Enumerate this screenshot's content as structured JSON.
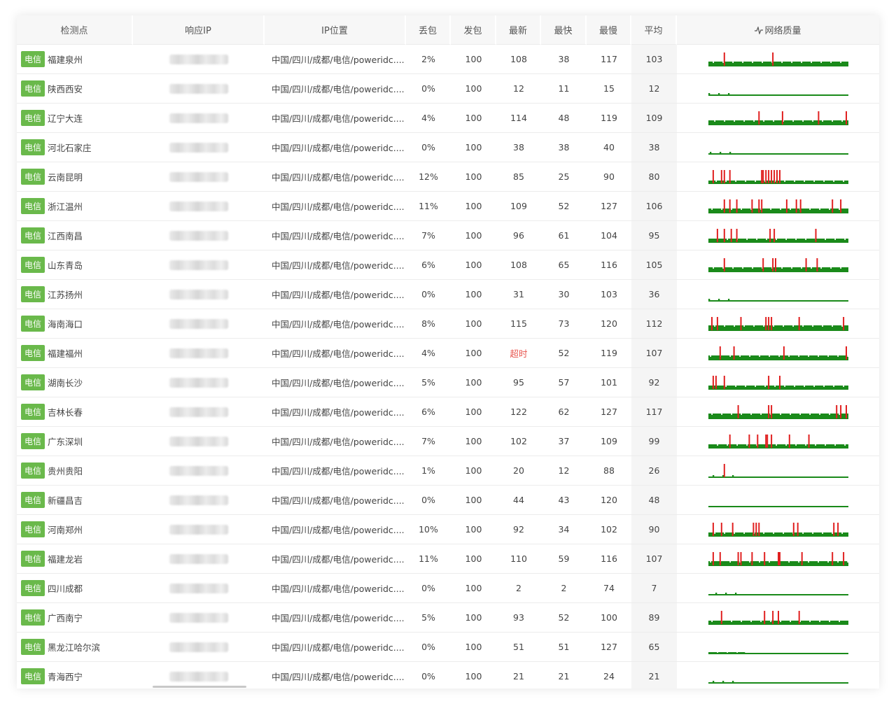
{
  "headers": {
    "node": "检测点",
    "ip": "响应IP",
    "location": "IP位置",
    "loss": "丢包",
    "sent": "发包",
    "latest": "最新",
    "fastest": "最快",
    "slowest": "最慢",
    "avg": "平均",
    "quality": "网络质量"
  },
  "colors": {
    "tag": "#6ab94b",
    "good": "#1a8a1a",
    "loss": "#e02020",
    "timeout": "#e8554e"
  },
  "rows": [
    {
      "isp": "电信",
      "city": "福建泉州",
      "location": "中国/四川/成都/电信/poweridc....",
      "loss": "2%",
      "sent": "100",
      "latest": "108",
      "fastest": "38",
      "slowest": "117",
      "avg": "103",
      "level": 0.5,
      "spikes": [
        0.11,
        0.46
      ]
    },
    {
      "isp": "电信",
      "city": "陕西西安",
      "location": "中国/四川/成都/电信/poweridc....",
      "loss": "0%",
      "sent": "100",
      "latest": "12",
      "fastest": "11",
      "slowest": "15",
      "avg": "12",
      "level": 0.05,
      "spikes": []
    },
    {
      "isp": "电信",
      "city": "辽宁大连",
      "location": "中国/四川/成都/电信/poweridc....",
      "loss": "4%",
      "sent": "100",
      "latest": "114",
      "fastest": "48",
      "slowest": "119",
      "avg": "109",
      "level": 0.52,
      "spikes": [
        0.36,
        0.53,
        0.79,
        0.99
      ]
    },
    {
      "isp": "电信",
      "city": "河北石家庄",
      "location": "中国/四川/成都/电信/poweridc....",
      "loss": "0%",
      "sent": "100",
      "latest": "38",
      "fastest": "38",
      "slowest": "40",
      "avg": "38",
      "level": 0.05,
      "spikes": []
    },
    {
      "isp": "电信",
      "city": "云南昆明",
      "location": "中国/四川/成都/电信/poweridc....",
      "loss": "12%",
      "sent": "100",
      "latest": "85",
      "fastest": "25",
      "slowest": "90",
      "avg": "80",
      "level": 0.3,
      "spikes": [
        0.03,
        0.09,
        0.11,
        0.15,
        0.38,
        0.39,
        0.41,
        0.43,
        0.45,
        0.47,
        0.49,
        0.51
      ]
    },
    {
      "isp": "电信",
      "city": "浙江温州",
      "location": "中国/四川/成都/电信/poweridc....",
      "loss": "11%",
      "sent": "100",
      "latest": "109",
      "fastest": "52",
      "slowest": "127",
      "avg": "106",
      "level": 0.52,
      "spikes": [
        0.11,
        0.15,
        0.2,
        0.31,
        0.36,
        0.38,
        0.56,
        0.63,
        0.66,
        0.89,
        0.95
      ]
    },
    {
      "isp": "电信",
      "city": "江西南昌",
      "location": "中国/四川/成都/电信/poweridc....",
      "loss": "7%",
      "sent": "100",
      "latest": "96",
      "fastest": "61",
      "slowest": "104",
      "avg": "95",
      "level": 0.45,
      "spikes": [
        0.06,
        0.11,
        0.16,
        0.2,
        0.44,
        0.47,
        0.77
      ]
    },
    {
      "isp": "电信",
      "city": "山东青岛",
      "location": "中国/四川/成都/电信/poweridc....",
      "loss": "6%",
      "sent": "100",
      "latest": "108",
      "fastest": "65",
      "slowest": "116",
      "avg": "105",
      "level": 0.5,
      "spikes": [
        0.11,
        0.39,
        0.46,
        0.48,
        0.7,
        0.78
      ]
    },
    {
      "isp": "电信",
      "city": "江苏扬州",
      "location": "中国/四川/成都/电信/poweridc....",
      "loss": "0%",
      "sent": "100",
      "latest": "31",
      "fastest": "30",
      "slowest": "103",
      "avg": "36",
      "level": 0.08,
      "spikes": []
    },
    {
      "isp": "电信",
      "city": "海南海口",
      "location": "中国/四川/成都/电信/poweridc....",
      "loss": "8%",
      "sent": "100",
      "latest": "115",
      "fastest": "73",
      "slowest": "120",
      "avg": "112",
      "level": 0.55,
      "spikes": [
        0.02,
        0.06,
        0.23,
        0.41,
        0.43,
        0.45,
        0.65,
        0.97
      ]
    },
    {
      "isp": "电信",
      "city": "福建福州",
      "location": "中国/四川/成都/电信/poweridc....",
      "loss": "4%",
      "sent": "100",
      "latest": "超时",
      "fastest": "52",
      "slowest": "119",
      "avg": "107",
      "level": 0.5,
      "spikes": [
        0.08,
        0.18,
        0.54,
        0.99
      ],
      "latest_timeout": true
    },
    {
      "isp": "电信",
      "city": "湖南长沙",
      "location": "中国/四川/成都/电信/poweridc....",
      "loss": "5%",
      "sent": "100",
      "latest": "95",
      "fastest": "57",
      "slowest": "101",
      "avg": "92",
      "level": 0.45,
      "spikes": [
        0.03,
        0.05,
        0.11,
        0.43,
        0.51
      ]
    },
    {
      "isp": "电信",
      "city": "吉林长春",
      "location": "中国/四川/成都/电信/poweridc....",
      "loss": "6%",
      "sent": "100",
      "latest": "122",
      "fastest": "62",
      "slowest": "127",
      "avg": "117",
      "level": 0.55,
      "spikes": [
        0.21,
        0.43,
        0.45,
        0.92,
        0.95,
        0.99
      ]
    },
    {
      "isp": "电信",
      "city": "广东深圳",
      "location": "中国/四川/成都/电信/poweridc....",
      "loss": "7%",
      "sent": "100",
      "latest": "102",
      "fastest": "37",
      "slowest": "109",
      "avg": "99",
      "level": 0.45,
      "spikes": [
        0.15,
        0.29,
        0.35,
        0.41,
        0.42,
        0.45,
        0.58,
        0.72
      ]
    },
    {
      "isp": "电信",
      "city": "贵州贵阳",
      "location": "中国/四川/成都/电信/poweridc....",
      "loss": "1%",
      "sent": "100",
      "latest": "20",
      "fastest": "12",
      "slowest": "88",
      "avg": "26",
      "level": 0.08,
      "spikes": [
        0.11
      ]
    },
    {
      "isp": "电信",
      "city": "新疆昌吉",
      "location": "中国/四川/成都/电信/poweridc....",
      "loss": "0%",
      "sent": "100",
      "latest": "44",
      "fastest": "43",
      "slowest": "120",
      "avg": "48",
      "level": 0.12,
      "spikes": []
    },
    {
      "isp": "电信",
      "city": "河南郑州",
      "location": "中国/四川/成都/电信/poweridc....",
      "loss": "10%",
      "sent": "100",
      "latest": "92",
      "fastest": "34",
      "slowest": "102",
      "avg": "90",
      "level": 0.45,
      "spikes": [
        0.03,
        0.09,
        0.17,
        0.32,
        0.34,
        0.36,
        0.61,
        0.64,
        0.9,
        0.93
      ]
    },
    {
      "isp": "电信",
      "city": "福建龙岩",
      "location": "中国/四川/成都/电信/poweridc....",
      "loss": "11%",
      "sent": "100",
      "latest": "110",
      "fastest": "59",
      "slowest": "116",
      "avg": "107",
      "level": 0.52,
      "spikes": [
        0.03,
        0.08,
        0.21,
        0.23,
        0.31,
        0.4,
        0.5,
        0.51,
        0.67,
        0.89,
        0.97
      ]
    },
    {
      "isp": "电信",
      "city": "四川成都",
      "location": "中国/四川/成都/电信/poweridc....",
      "loss": "0%",
      "sent": "100",
      "latest": "2",
      "fastest": "2",
      "slowest": "74",
      "avg": "7",
      "level": 0.04,
      "spikes": []
    },
    {
      "isp": "电信",
      "city": "广西南宁",
      "location": "中国/四川/成都/电信/poweridc....",
      "loss": "5%",
      "sent": "100",
      "latest": "93",
      "fastest": "52",
      "slowest": "100",
      "avg": "89",
      "level": 0.45,
      "spikes": [
        0.09,
        0.4,
        0.46,
        0.5,
        0.65
      ]
    },
    {
      "isp": "电信",
      "city": "黑龙江哈尔滨",
      "location": "中国/四川/成都/电信/poweridc....",
      "loss": "0%",
      "sent": "100",
      "latest": "51",
      "fastest": "51",
      "slowest": "127",
      "avg": "65",
      "level": 0.2,
      "spikes": []
    },
    {
      "isp": "电信",
      "city": "青海西宁",
      "location": "中国/四川/成都/电信/poweridc....",
      "loss": "0%",
      "sent": "100",
      "latest": "21",
      "fastest": "21",
      "slowest": "24",
      "avg": "21",
      "level": 0.05,
      "spikes": []
    }
  ]
}
